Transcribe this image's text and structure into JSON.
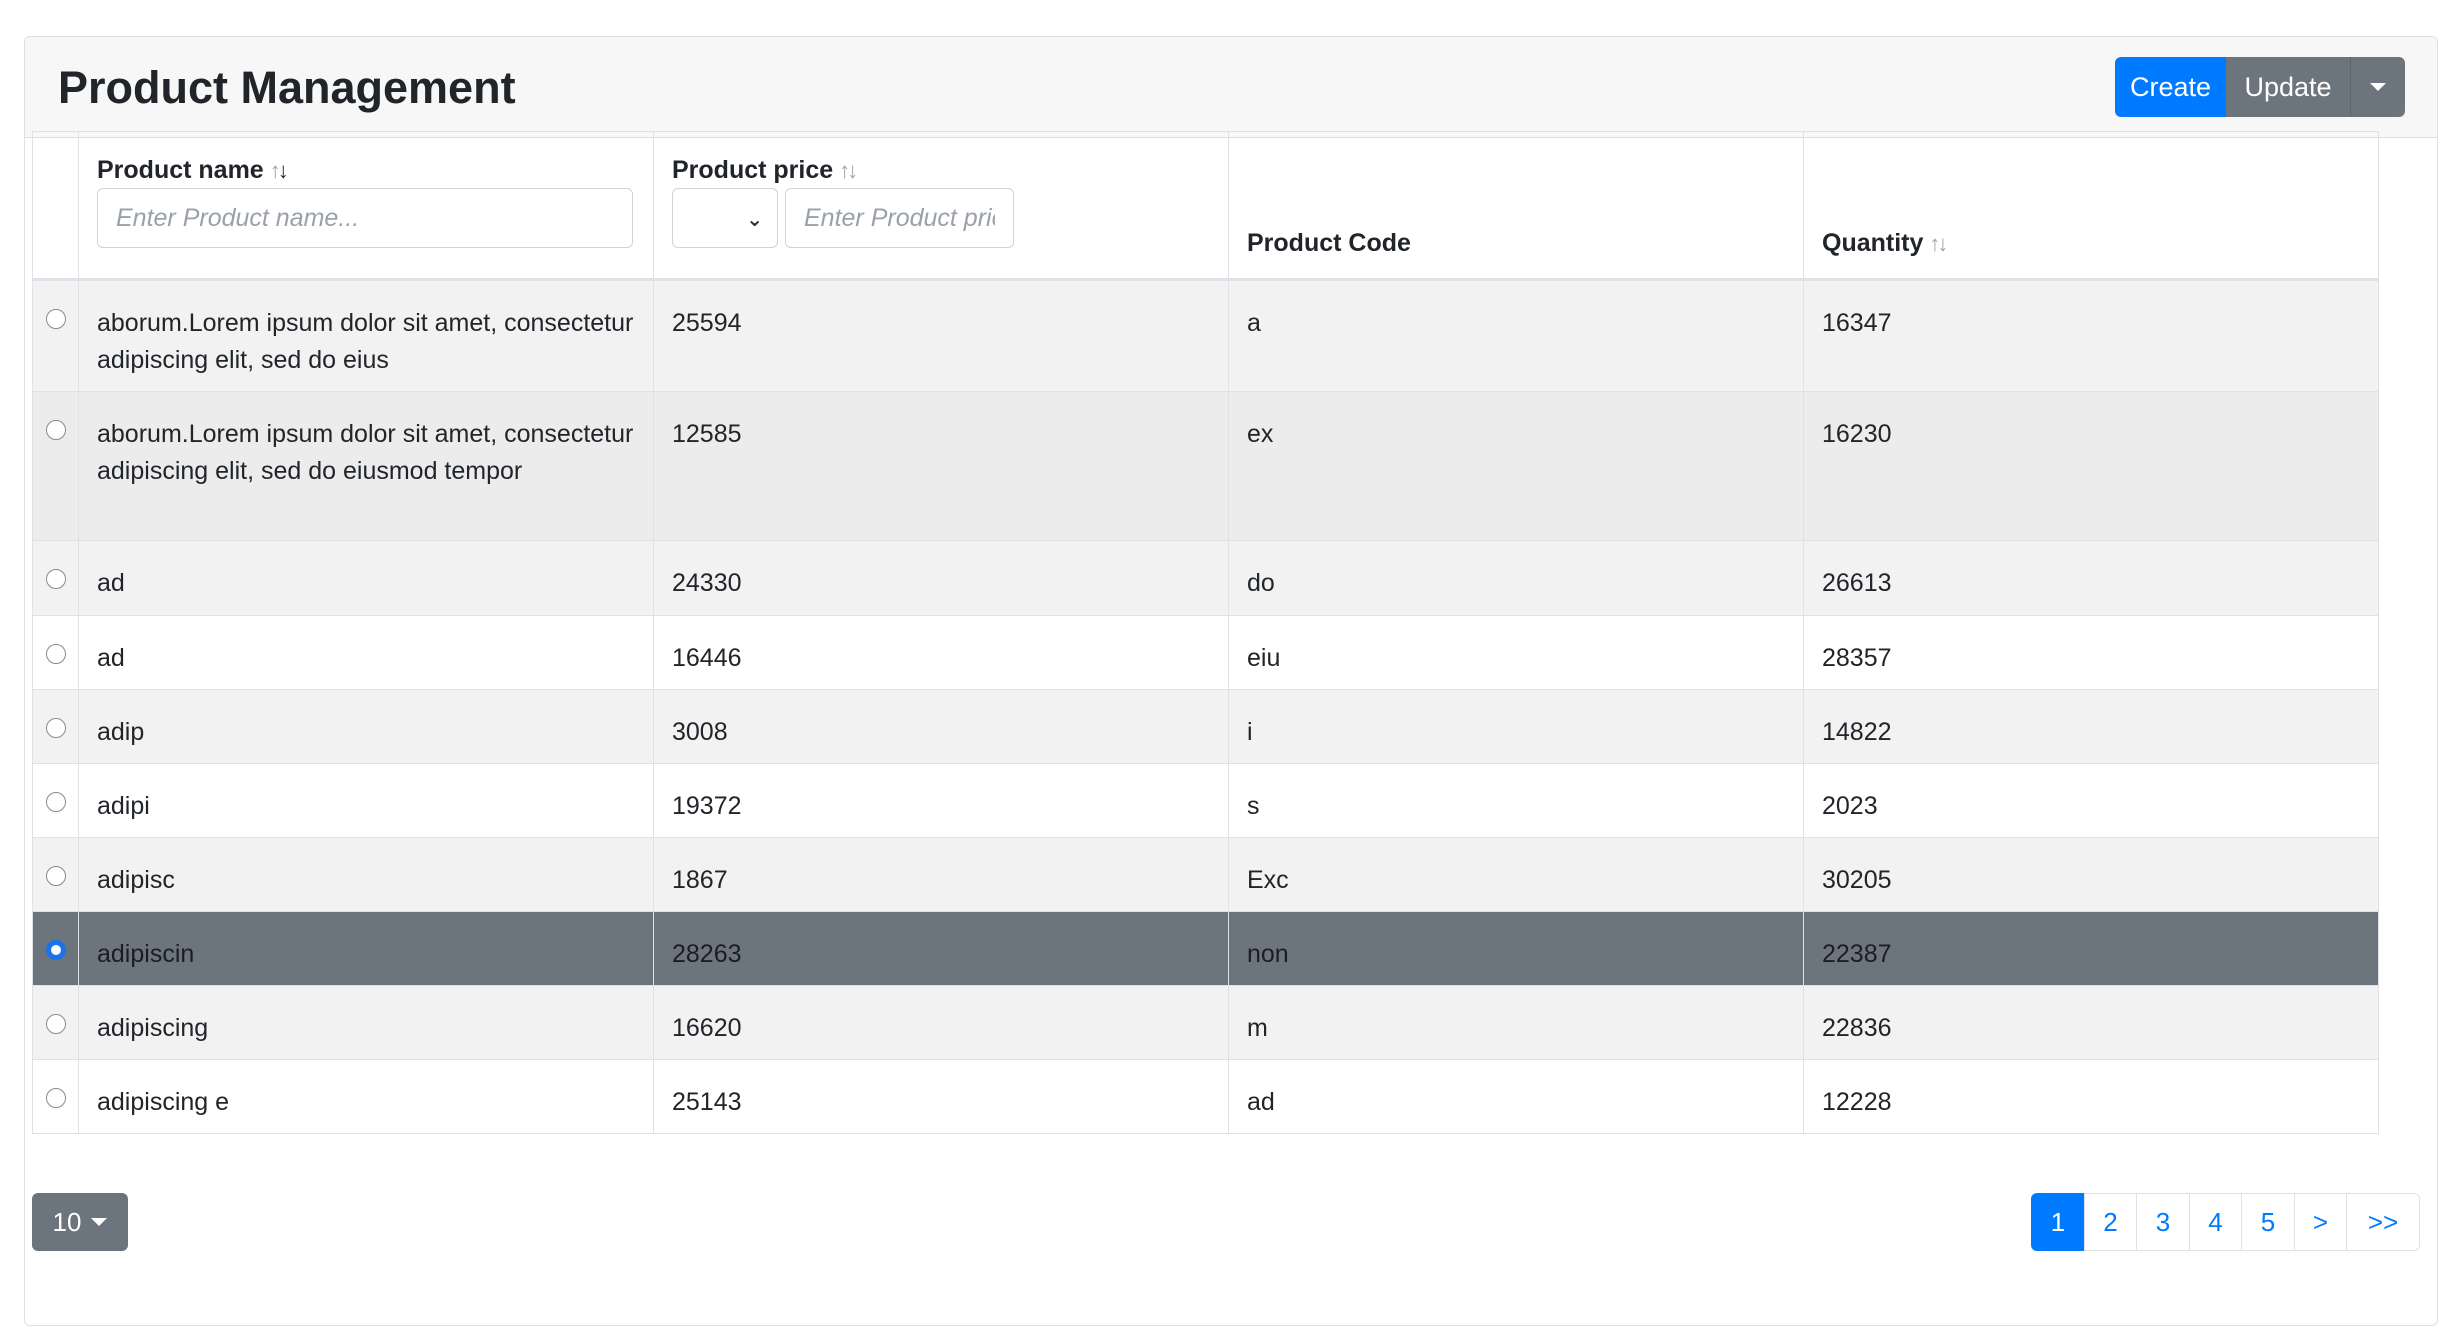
{
  "header": {
    "title": "Product Management",
    "create_label": "Create",
    "update_label": "Update"
  },
  "table": {
    "columns": {
      "product_name": {
        "label": "Product name",
        "placeholder": "Enter Product name..."
      },
      "product_price": {
        "label": "Product price",
        "placeholder": "Enter Product price..."
      },
      "product_code": {
        "label": "Product Code"
      },
      "quantity": {
        "label": "Quantity"
      }
    },
    "sort_icon": {
      "up": "↑",
      "down": "↓"
    },
    "rows": [
      {
        "name": "aborum.Lorem ipsum dolor sit amet, consectetur adipiscing elit, sed do eius",
        "price": "25594",
        "code": "a",
        "quantity": "16347",
        "selected": false
      },
      {
        "name": "aborum.Lorem ipsum dolor sit amet, consectetur adipiscing elit, sed do eiusmod tempor",
        "price": "12585",
        "code": "ex",
        "quantity": "16230",
        "selected": false
      },
      {
        "name": "ad",
        "price": "24330",
        "code": "do",
        "quantity": "26613",
        "selected": false
      },
      {
        "name": "ad",
        "price": "16446",
        "code": "eiu",
        "quantity": "28357",
        "selected": false
      },
      {
        "name": "adip",
        "price": "3008",
        "code": "i",
        "quantity": "14822",
        "selected": false
      },
      {
        "name": "adipi",
        "price": "19372",
        "code": "s",
        "quantity": "2023",
        "selected": false
      },
      {
        "name": "adipisc",
        "price": "1867",
        "code": "Exc",
        "quantity": "30205",
        "selected": false
      },
      {
        "name": "adipiscin",
        "price": "28263",
        "code": "non",
        "quantity": "22387",
        "selected": true
      },
      {
        "name": "adipiscing",
        "price": "16620",
        "code": "m",
        "quantity": "22836",
        "selected": false
      },
      {
        "name": "adipiscing e",
        "price": "25143",
        "code": "ad",
        "quantity": "12228",
        "selected": false
      }
    ]
  },
  "footer": {
    "page_size": "10",
    "pages": [
      "1",
      "2",
      "3",
      "4",
      "5",
      ">",
      ">>"
    ],
    "active_page": "1"
  },
  "colors": {
    "primary": "#007bff",
    "secondary": "#6c757d"
  }
}
